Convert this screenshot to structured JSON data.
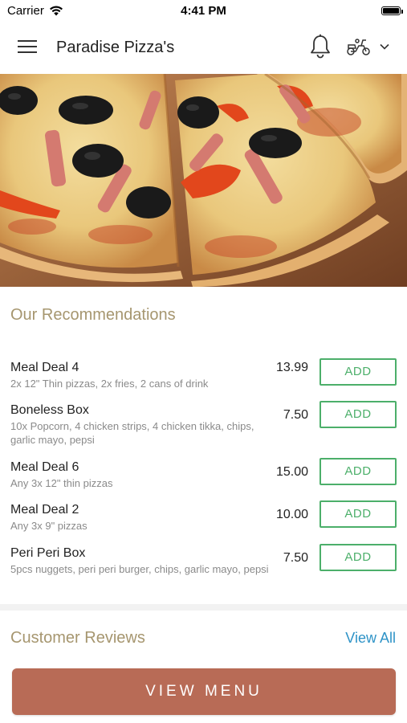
{
  "status_bar": {
    "carrier": "Carrier",
    "time": "4:41 PM"
  },
  "nav": {
    "title": "Paradise Pizza's",
    "icons": [
      "menu-icon",
      "bell-icon",
      "scooter-icon",
      "chevron-down-icon"
    ]
  },
  "recommendations": {
    "title": "Our Recommendations",
    "add_label": "ADD",
    "items": [
      {
        "name": "Meal Deal 4",
        "desc": "2x 12\" Thin pizzas, 2x fries, 2 cans of drink",
        "price": "13.99"
      },
      {
        "name": "Boneless Box",
        "desc": "10x Popcorn, 4 chicken strips, 4 chicken tikka, chips, garlic mayo, pepsi",
        "price": "7.50"
      },
      {
        "name": "Meal Deal 6",
        "desc": "Any 3x 12\" thin pizzas",
        "price": "15.00"
      },
      {
        "name": "Meal Deal 2",
        "desc": "Any 3x 9\" pizzas",
        "price": "10.00"
      },
      {
        "name": "Peri Peri Box",
        "desc": "5pcs nuggets, peri peri burger, chips, garlic mayo, pepsi",
        "price": "7.50"
      }
    ]
  },
  "reviews": {
    "title": "Customer Reviews",
    "view_all": "View All"
  },
  "cta": {
    "label": "VIEW MENU"
  },
  "colors": {
    "accent_green": "#4caf6a",
    "section_title": "#a6966f",
    "link_blue": "#2e93c7",
    "cta_bg": "#b86b56"
  }
}
